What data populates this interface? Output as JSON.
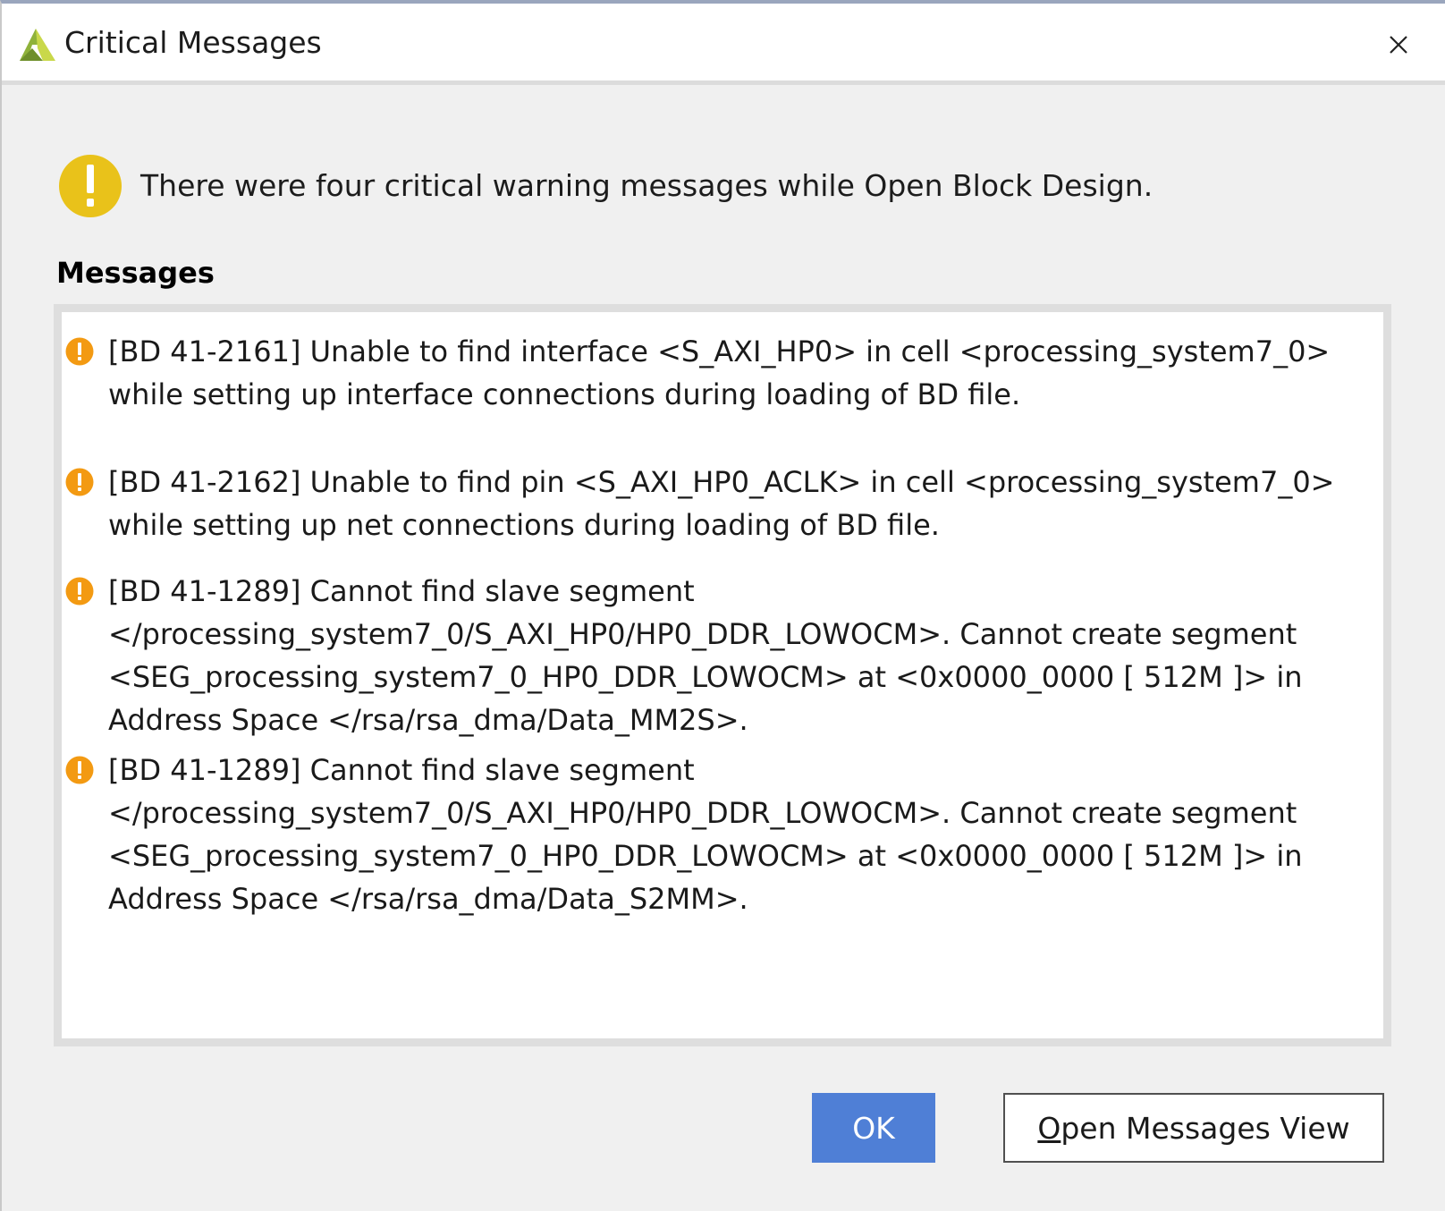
{
  "window": {
    "title": "Critical Messages"
  },
  "summary": "There were four critical warning messages while Open Block Design.",
  "section_label": "Messages",
  "messages": [
    {
      "lines": [
        "[BD 41-2161] Unable to find interface <S_AXI_HP0> in cell <processing_system7_0>",
        "while setting up interface connections during loading of BD file."
      ]
    },
    {
      "lines": [
        "[BD 41-2162] Unable to find pin <S_AXI_HP0_ACLK> in cell <processing_system7_0>",
        "while setting up net connections during loading of BD file."
      ]
    },
    {
      "lines": [
        "[BD 41-1289] Cannot find slave segment",
        "</processing_system7_0/S_AXI_HP0/HP0_DDR_LOWOCM>. Cannot create segment",
        "<SEG_processing_system7_0_HP0_DDR_LOWOCM> at <0x0000_0000 [ 512M ]> in",
        "Address Space </rsa/rsa_dma/Data_MM2S>."
      ]
    },
    {
      "lines": [
        "[BD 41-1289] Cannot find slave segment",
        "</processing_system7_0/S_AXI_HP0/HP0_DDR_LOWOCM>. Cannot create segment",
        "<SEG_processing_system7_0_HP0_DDR_LOWOCM> at <0x0000_0000 [ 512M ]> in",
        "Address Space </rsa/rsa_dma/Data_S2MM>."
      ]
    }
  ],
  "buttons": {
    "ok_label": "OK",
    "open_view_mnemonic": "O",
    "open_view_rest": "pen Messages View"
  },
  "icons": {
    "app_logo": "vivado-logo-icon",
    "close": "close-icon",
    "summary_warning": "warning-icon",
    "message_warning": "critical-warning-icon"
  },
  "colors": {
    "ok_button": "#4f7fd6",
    "summary_warning": "#e9c21a",
    "message_warning": "#f39a12"
  }
}
